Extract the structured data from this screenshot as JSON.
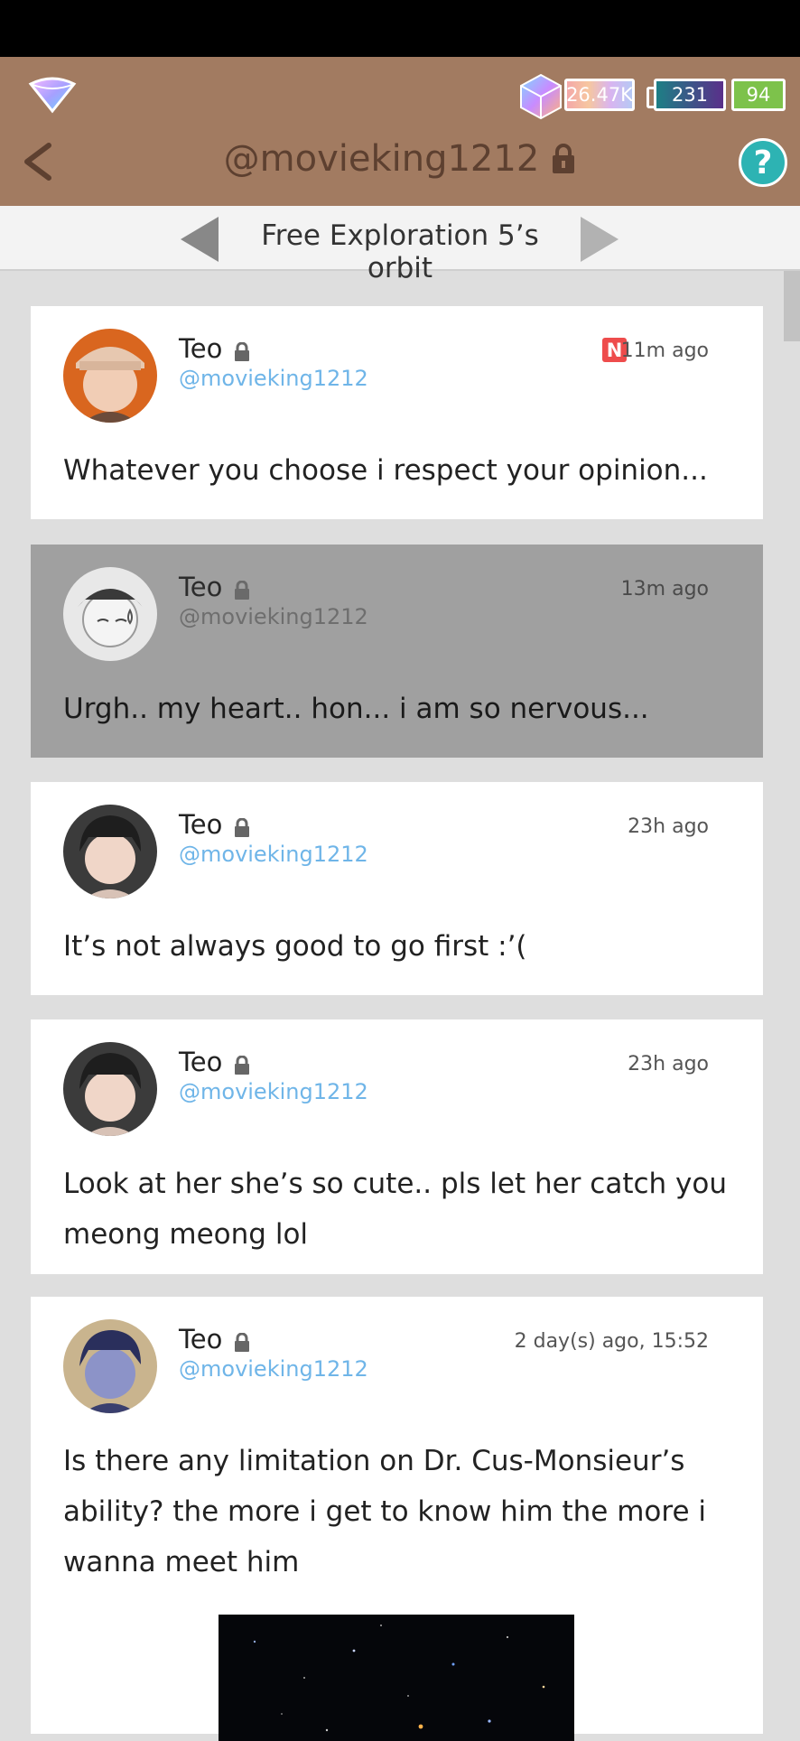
{
  "header": {
    "title": "@movieking1212",
    "hourglass_count": "26.47K",
    "battery_count": "231",
    "energy_count": "94",
    "help_label": "?"
  },
  "orbit": {
    "label": "Free Exploration 5’s orbit"
  },
  "posts": [
    {
      "name": "Teo",
      "handle": "@movieking1212",
      "time": "11m ago",
      "new_badge": "N",
      "message": "Whatever you choose i respect your opinion..."
    },
    {
      "name": "Teo",
      "handle": "@movieking1212",
      "time": "13m ago",
      "message": "Urgh.. my heart.. hon... i am so nervous..."
    },
    {
      "name": "Teo",
      "handle": "@movieking1212",
      "time": "23h ago",
      "message": "It’s not always good to go first :’("
    },
    {
      "name": "Teo",
      "handle": "@movieking1212",
      "time": "23h ago",
      "message": "Look at her she’s so cute.. pls let her catch you meong meong lol"
    },
    {
      "name": "Teo",
      "handle": "@movieking1212",
      "time": "2 day(s) ago, 15:52",
      "message": "Is there any limitation on Dr. Cus-Monsieur’s ability? the more i get to know him the more i wanna meet him"
    }
  ],
  "colors": {
    "header_bg": "#a27b61",
    "title_color": "#5d4030",
    "handle_blue": "#6fb5e8",
    "help_teal": "#2db3b3",
    "new_badge_red": "#ee4c4c"
  }
}
